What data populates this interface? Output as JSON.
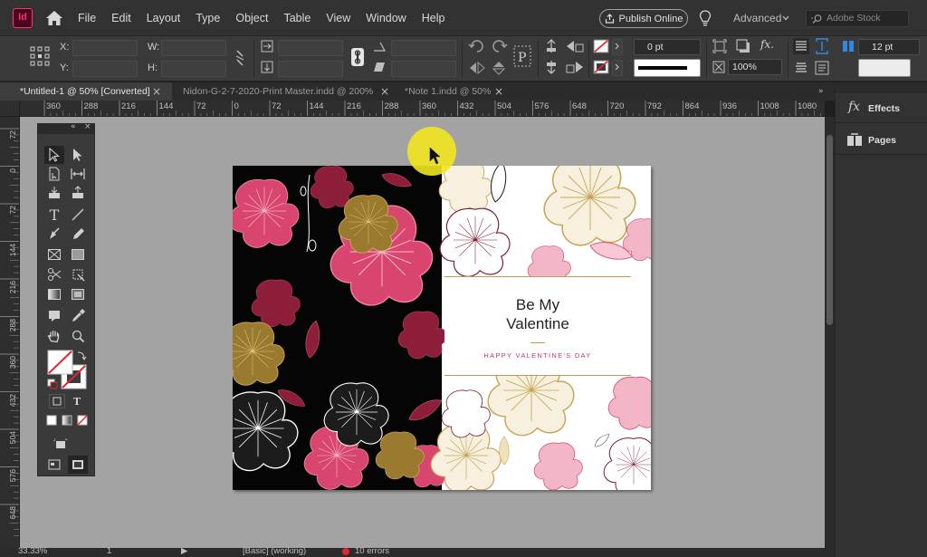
{
  "app": {
    "logo_text": "Id",
    "brand_color": "#ff3366"
  },
  "menu": [
    "File",
    "Edit",
    "Layout",
    "Type",
    "Object",
    "Table",
    "View",
    "Window",
    "Help"
  ],
  "header": {
    "publish_label": "Publish Online",
    "workspace_label": "Advanced",
    "stock_placeholder": "Adobe Stock"
  },
  "control_panel": {
    "x_label": "X:",
    "y_label": "Y:",
    "w_label": "W:",
    "h_label": "H:",
    "stroke_weight": "0 pt",
    "opacity": "100%",
    "gutter": "12 pt"
  },
  "tabs": [
    {
      "label": "*Untitled-1 @ 50% [Converted]",
      "active": true
    },
    {
      "label": "Nidon-G-2-7-2020-Print Master.indd @ 200%",
      "active": false
    },
    {
      "label": "*Note 1.indd @ 50%",
      "active": false
    }
  ],
  "ruler": {
    "h_ticks": [
      "360",
      "288",
      "216",
      "144",
      "72",
      "0",
      "72",
      "144",
      "216",
      "288",
      "360",
      "432",
      "504",
      "576",
      "648",
      "720",
      "792",
      "864",
      "936",
      "1008",
      "1080"
    ],
    "v_ticks": [
      "7 2",
      "0",
      "7 2",
      "1 4 4",
      "2 1 6",
      "2 8 8",
      "3 6 0",
      "4 3 2",
      "5 0 4",
      "5 7 6",
      "6 4 8"
    ]
  },
  "card": {
    "title_line1": "Be My",
    "title_line2": "Valentine",
    "subtitle": "HAPPY VALENTINE'S DAY"
  },
  "panels": {
    "effects_label": "Effects",
    "pages_label": "Pages"
  },
  "status": {
    "zoom": "33.33%",
    "page": "1",
    "style": "[Basic] (working)",
    "errors": "10 errors"
  }
}
